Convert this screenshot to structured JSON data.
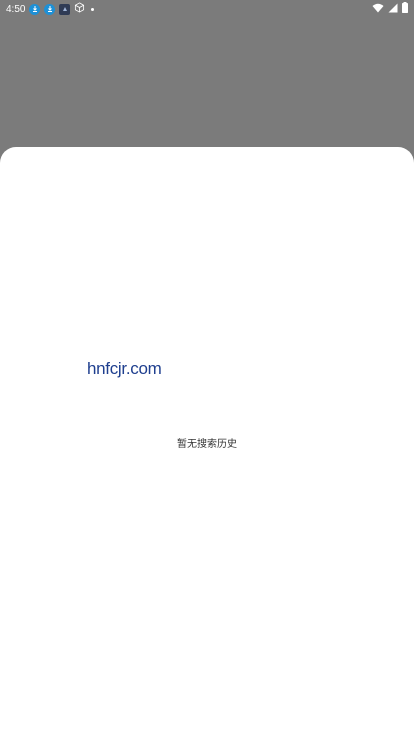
{
  "status_bar": {
    "time": "4:50",
    "icons": [
      "download-notification-icon",
      "download-notification-icon",
      "app-notification-icon",
      "cube-icon",
      "dot-icon"
    ],
    "right_icons": [
      "wifi-icon",
      "signal-icon",
      "battery-icon"
    ]
  },
  "sheet": {
    "watermark": "hnfcjr.com",
    "empty_message": "暂无搜索历史"
  },
  "colors": {
    "scrim": "#7b7b7b",
    "sheet_bg": "#ffffff",
    "watermark": "#1f3f8f",
    "notif_blue": "#1e90d6"
  }
}
